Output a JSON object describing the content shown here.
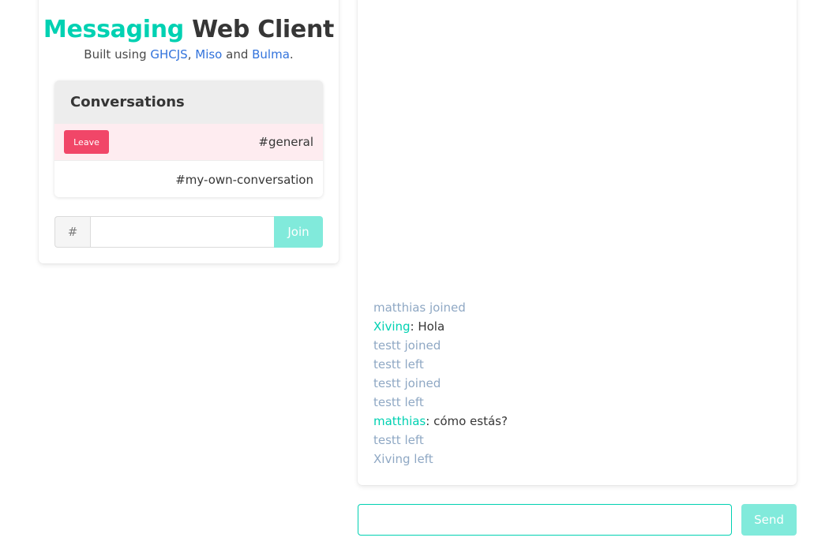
{
  "header": {
    "title_accent": "Messaging",
    "title_rest": "Web Client",
    "subtitle_prefix": "Built using ",
    "subtitle_links": [
      "GHCJS",
      "Miso",
      "Bulma"
    ],
    "subtitle_sep1": ", ",
    "subtitle_sep2": " and ",
    "subtitle_suffix": "."
  },
  "conversations": {
    "heading": "Conversations",
    "items": [
      {
        "name": "#general",
        "active": true,
        "leave_label": "Leave"
      },
      {
        "name": "#my-own-conversation",
        "active": false
      }
    ]
  },
  "join": {
    "prefix": "#",
    "input_value": "",
    "button_label": "Join"
  },
  "messages": [
    {
      "type": "system",
      "text": "matthias joined"
    },
    {
      "type": "chat",
      "author": "Xiving",
      "text": ": Hola"
    },
    {
      "type": "system",
      "text": "testt joined"
    },
    {
      "type": "system",
      "text": "testt left"
    },
    {
      "type": "system",
      "text": "testt joined"
    },
    {
      "type": "system",
      "text": "testt left"
    },
    {
      "type": "chat",
      "author": "matthias",
      "text": ": cómo estás?"
    },
    {
      "type": "system",
      "text": "testt left"
    },
    {
      "type": "system",
      "text": "Xiving left"
    }
  ],
  "composer": {
    "input_value": "",
    "send_label": "Send"
  },
  "colors": {
    "primary": "#00d1b2",
    "danger": "#f14668",
    "link": "#3273dc",
    "system_text": "#8fa8c4"
  }
}
